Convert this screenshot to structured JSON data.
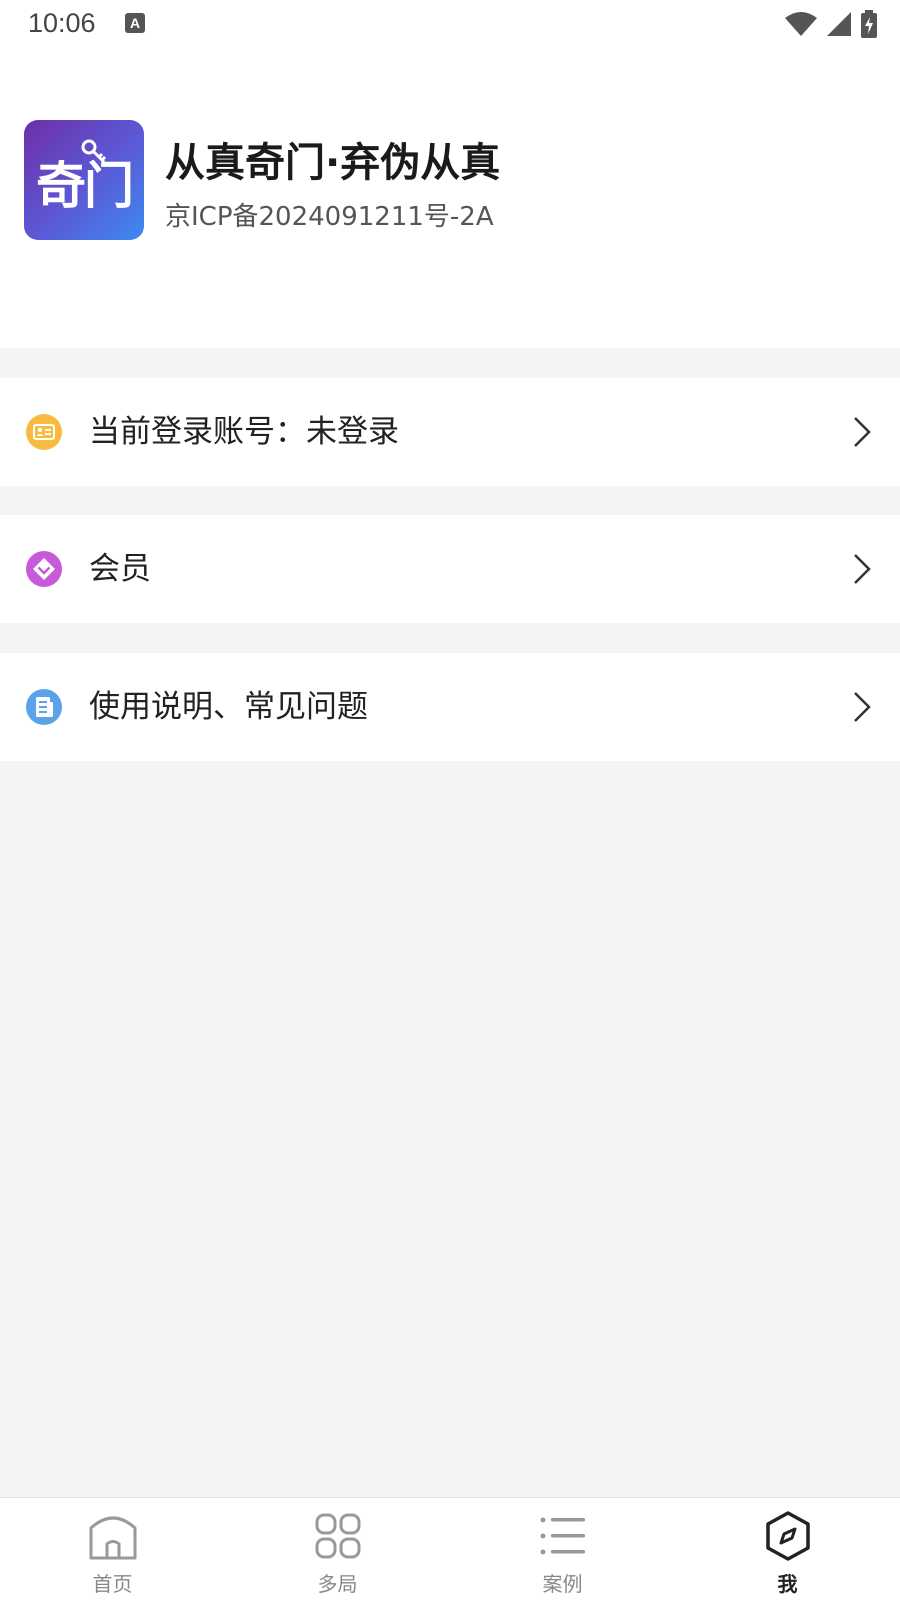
{
  "status_bar": {
    "time": "10:06",
    "notification_glyph": "A"
  },
  "header": {
    "logo_text": "奇门",
    "title": "从真奇门·弃伪从真",
    "subtitle": "京ICP备2024091211号-2A"
  },
  "menu": {
    "items": [
      {
        "label": "当前登录账号：未登录",
        "icon": "id-card-icon",
        "color": "#f7bb40"
      },
      {
        "label": "会员",
        "icon": "vip-diamond-icon",
        "color": "#c75ad9"
      },
      {
        "label": "使用说明、常见问题",
        "icon": "document-icon",
        "color": "#5aa3ea"
      }
    ]
  },
  "tab_bar": {
    "tabs": [
      {
        "label": "首页",
        "icon": "home-icon",
        "active": false
      },
      {
        "label": "多局",
        "icon": "grid-icon",
        "active": false
      },
      {
        "label": "案例",
        "icon": "list-icon",
        "active": false
      },
      {
        "label": "我",
        "icon": "compass-icon",
        "active": true
      }
    ]
  },
  "colors": {
    "background": "#f4f4f4",
    "surface": "#ffffff",
    "text_primary": "#222222",
    "text_secondary": "#888888"
  }
}
